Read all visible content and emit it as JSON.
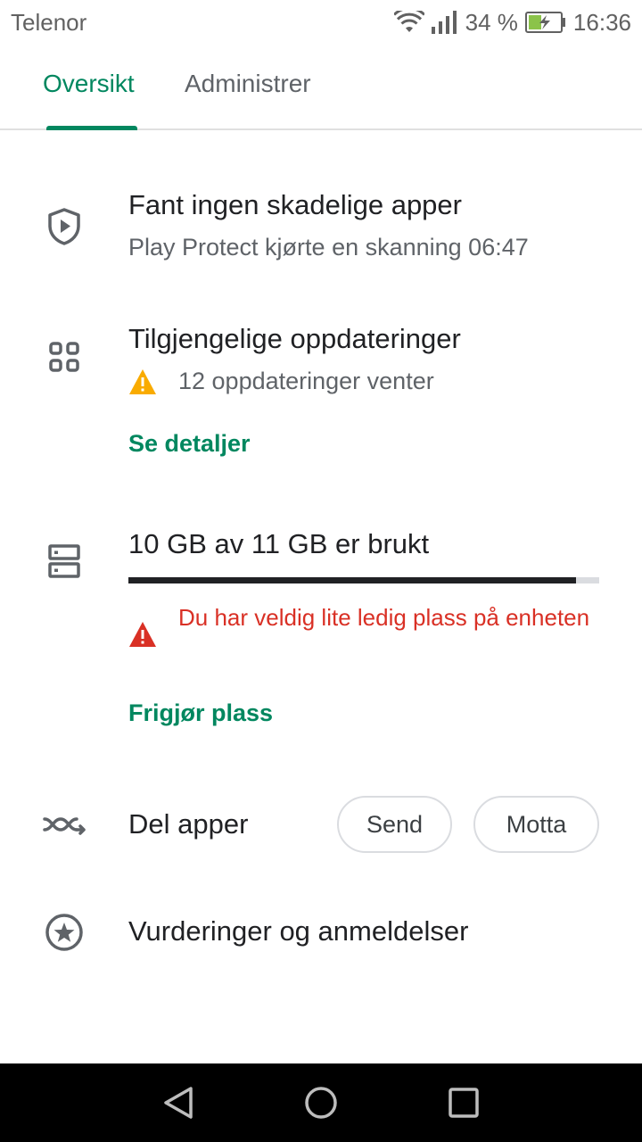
{
  "status_bar": {
    "carrier": "Telenor",
    "battery": "34 %",
    "time": "16:36"
  },
  "tabs": [
    {
      "label": "Oversikt",
      "active": true
    },
    {
      "label": "Administrer",
      "active": false
    }
  ],
  "protect": {
    "icon": "shield-play-icon",
    "title": "Fant ingen skadelige apper",
    "subtitle": "Play Protect kjørte en skanning 06:47"
  },
  "updates": {
    "icon": "apps-grid-icon",
    "title": "Tilgjengelige oppdateringer",
    "status": "12 oppdateringer venter",
    "status_icon": "warning-triangle-icon",
    "link": "Se detaljer"
  },
  "storage": {
    "icon": "storage-icon",
    "title": "10 GB av 11 GB er brukt",
    "used_fraction": 0.95,
    "warning": "Du har veldig lite ledig plass på enheten",
    "warning_icon": "error-triangle-icon",
    "link": "Frigjør plass"
  },
  "share": {
    "icon": "share-apps-icon",
    "title": "Del apper",
    "send_label": "Send",
    "receive_label": "Motta"
  },
  "ratings": {
    "icon": "star-circle-icon",
    "title": "Vurderinger og anmeldelser"
  },
  "colors": {
    "accent": "#01875f",
    "warning": "#f9ab00",
    "error": "#d93025"
  }
}
